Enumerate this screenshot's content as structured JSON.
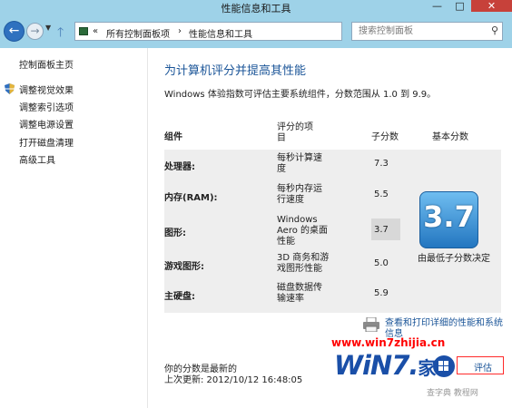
{
  "window": {
    "title": "性能信息和工具",
    "controls": {
      "minimize": "—",
      "maximize": "□",
      "close": "✕"
    }
  },
  "nav": {
    "back_icon": "arrow-left-icon",
    "forward_icon": "arrow-right-icon",
    "up_icon": "arrow-up-icon",
    "address": {
      "overflow": "«",
      "segments": [
        "所有控制面板项",
        "性能信息和工具"
      ],
      "separator": "›"
    },
    "search_placeholder": "搜索控制面板"
  },
  "sidebar": {
    "home": "控制面板主页",
    "items": [
      {
        "label": "调整视觉效果",
        "icon": "shield-icon"
      },
      {
        "label": "调整索引选项"
      },
      {
        "label": "调整电源设置"
      },
      {
        "label": "打开磁盘清理"
      },
      {
        "label": "高级工具"
      }
    ]
  },
  "main": {
    "heading": "为计算机评分并提高其性能",
    "description": "Windows 体验指数可评估主要系统组件，分数范围从 1.0 到 9.9。",
    "table": {
      "headers": {
        "component": "组件",
        "rated": "评分的项\n目",
        "subscore": "子分数",
        "base": "基本分数"
      },
      "rows": [
        {
          "component": "处理器:",
          "desc": "每秒计算速\n度",
          "score": "7.3"
        },
        {
          "component": "内存(RAM):",
          "desc": "每秒内存运\n行速度",
          "score": "5.5"
        },
        {
          "component": "图形:",
          "desc": "Windows\nAero 的桌面\n性能",
          "score": "3.7"
        },
        {
          "component": "游戏图形:",
          "desc": "3D 商务和游\n戏图形性能",
          "score": "5.0"
        },
        {
          "component": "主硬盘:",
          "desc": "磁盘数据传\n输速率",
          "score": "5.9"
        }
      ],
      "base_score": "3.7",
      "base_caption": "由最低子分数决定"
    },
    "print_link": "查看和打印详细的性能和系统信息",
    "status_fresh": "你的分数是最新的",
    "last_update": "上次更新: 2012/10/12 16:48:05",
    "rerun_button": "评估"
  },
  "watermark": {
    "url": "www.win7zhijia.cn",
    "logo": "WiN7.",
    "logo_suffix": "家",
    "bottom": "查字典 教程网"
  },
  "colors": {
    "titlebar": "#9ed2e8",
    "link": "#1b5598",
    "close": "#c7413a",
    "badge": "#2376c0",
    "watermark_red": "#ff0000"
  }
}
